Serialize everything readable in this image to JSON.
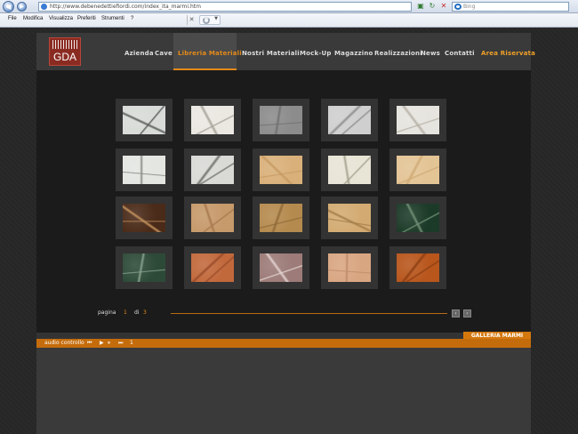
{
  "browser": {
    "address": "http://www.debenedettiefiordi.com/index_ita_marmi.htm",
    "search_placeholder": "Bing",
    "menu": [
      "File",
      "Modifica",
      "Visualizza",
      "Preferiti",
      "Strumenti",
      "?"
    ]
  },
  "site": {
    "logo_text": "GDA",
    "nav": [
      {
        "label": "Azienda"
      },
      {
        "label": "Cave"
      },
      {
        "label": "Libreria Materiali"
      },
      {
        "label": "Nostri Materiali"
      },
      {
        "label": "Mock-Up"
      },
      {
        "label": "Magazzino"
      },
      {
        "label": "Realizzazioni"
      },
      {
        "label": "News"
      },
      {
        "label": "Contatti"
      },
      {
        "label": "Area Riservata"
      }
    ],
    "active_nav": "Libreria Materiali",
    "pager": {
      "label": "pagina",
      "current": "1",
      "of": "di",
      "total": "3"
    },
    "gallery_label": "GALLERIA MARMI",
    "audio_label": "audio controllo",
    "audio_controls": [
      "⏮",
      "▶",
      "⏸",
      "⏭",
      "1"
    ],
    "materials": [
      {
        "color": "#d8dbd8",
        "vein": "#5a5e5a"
      },
      {
        "color": "#ebe8e2",
        "vein": "#a8a49a"
      },
      {
        "color": "#8c8c8c",
        "vein": "#707070"
      },
      {
        "color": "#cfcfcf",
        "vein": "#8f8f8f"
      },
      {
        "color": "#e6e4de",
        "vein": "#b7b2a8"
      },
      {
        "color": "#e4e6e2",
        "vein": "#8a8d88"
      },
      {
        "color": "#d9dad6",
        "vein": "#6e716c"
      },
      {
        "color": "#d9b07a",
        "vein": "#c79b62"
      },
      {
        "color": "#e8e4d6",
        "vein": "#a8a492"
      },
      {
        "color": "#e3c495",
        "vein": "#cfab76"
      },
      {
        "color": "#4a2a18",
        "vein": "#c2915c"
      },
      {
        "color": "#c69a6b",
        "vein": "#a97a4e"
      },
      {
        "color": "#b58a4e",
        "vein": "#8f6a38"
      },
      {
        "color": "#d3ab72",
        "vein": "#a47e4a"
      },
      {
        "color": "#1c3a28",
        "vein": "#6f8f74"
      },
      {
        "color": "#2d4a38",
        "vein": "#86a08c"
      },
      {
        "color": "#c2693c",
        "vein": "#9a4c2a"
      },
      {
        "color": "#9c7b78",
        "vein": "#e2d2d0"
      },
      {
        "color": "#d9a682",
        "vein": "#c08c6a"
      },
      {
        "color": "#b8561c",
        "vein": "#8e3e12"
      }
    ]
  }
}
